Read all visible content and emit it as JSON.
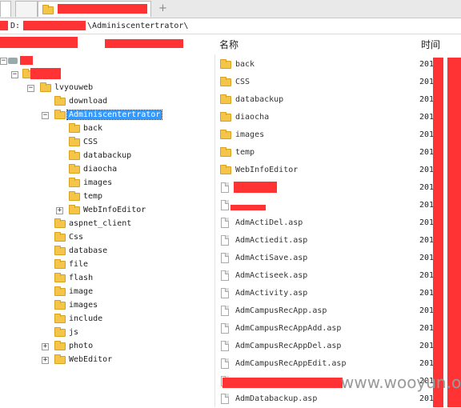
{
  "tabs": {
    "new_tab_label": "+"
  },
  "address": {
    "drive": "D:",
    "path": "\\Adminiscentertrator\\"
  },
  "columns": {
    "name": "名称",
    "time": "时间"
  },
  "tree": [
    {
      "label": "lvyouweb",
      "expander": "−"
    },
    {
      "label": "download"
    },
    {
      "label": "Adminiscentertrator",
      "expander": "−",
      "selected": true
    },
    {
      "label": "back"
    },
    {
      "label": "CSS"
    },
    {
      "label": "databackup"
    },
    {
      "label": "diaocha"
    },
    {
      "label": "images"
    },
    {
      "label": "temp"
    },
    {
      "label": "WebInfoEditor",
      "expander": "+"
    },
    {
      "label": "aspnet_client"
    },
    {
      "label": "Css"
    },
    {
      "label": "database"
    },
    {
      "label": "file"
    },
    {
      "label": "flash"
    },
    {
      "label": "image"
    },
    {
      "label": "images"
    },
    {
      "label": "include"
    },
    {
      "label": "js"
    },
    {
      "label": "photo",
      "expander": "+"
    },
    {
      "label": "WebEditor",
      "expander": "+"
    }
  ],
  "files": [
    {
      "name": "back",
      "type": "folder",
      "time": "201"
    },
    {
      "name": "CSS",
      "type": "folder",
      "time": "201"
    },
    {
      "name": "databackup",
      "type": "folder",
      "time": "201"
    },
    {
      "name": "diaocha",
      "type": "folder",
      "time": "201"
    },
    {
      "name": "images",
      "type": "folder",
      "time": "201"
    },
    {
      "name": "temp",
      "type": "folder",
      "time": "201"
    },
    {
      "name": "WebInfoEditor",
      "type": "folder",
      "time": "201"
    },
    {
      "name": "",
      "type": "file",
      "time": "201"
    },
    {
      "name": "",
      "type": "file",
      "time": "201"
    },
    {
      "name": "AdmActiDel.asp",
      "type": "file",
      "time": "201"
    },
    {
      "name": "AdmActiedit.asp",
      "type": "file",
      "time": "201"
    },
    {
      "name": "AdmActiSave.asp",
      "type": "file",
      "time": "201"
    },
    {
      "name": "AdmActiseek.asp",
      "type": "file",
      "time": "201"
    },
    {
      "name": "AdmActivity.asp",
      "type": "file",
      "time": "201"
    },
    {
      "name": "AdmCampusRecApp.asp",
      "type": "file",
      "time": "201"
    },
    {
      "name": "AdmCampusRecAppAdd.asp",
      "type": "file",
      "time": "201"
    },
    {
      "name": "AdmCampusRecAppDel.asp",
      "type": "file",
      "time": "201"
    },
    {
      "name": "AdmCampusRecAppEdit.asp",
      "type": "file",
      "time": "201"
    },
    {
      "name": "",
      "type": "file",
      "time": "201"
    },
    {
      "name": "AdmDatabackup.asp",
      "type": "file",
      "time": "201"
    }
  ],
  "watermark": "www.wooyun.org",
  "colors": {
    "redaction": "#ff3333",
    "selection": "#3399ff",
    "folder": "#f5c54a"
  }
}
